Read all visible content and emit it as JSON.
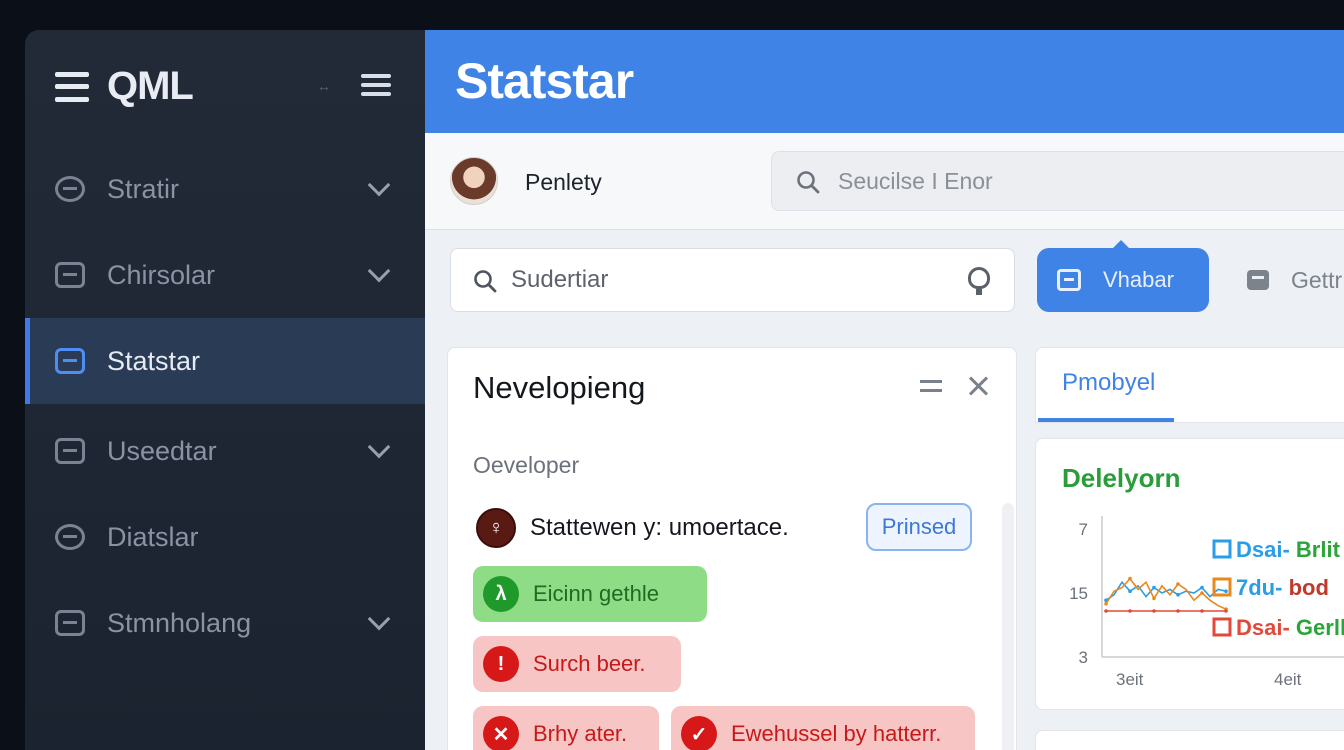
{
  "sidebar": {
    "brand": "QML",
    "arrows": "↔",
    "items": [
      {
        "label": "Stratir",
        "icon": "gauge-icon",
        "chevron": true,
        "active": false
      },
      {
        "label": "Chirsolar",
        "icon": "card-icon",
        "chevron": true,
        "active": false
      },
      {
        "label": "Statstar",
        "icon": "list-icon",
        "chevron": false,
        "active": true
      },
      {
        "label": "Useedtar",
        "icon": "card-icon",
        "chevron": true,
        "active": false
      },
      {
        "label": "Diatslar",
        "icon": "gauge-icon",
        "chevron": false,
        "active": false
      },
      {
        "label": "Stmnholang",
        "icon": "card-icon",
        "chevron": true,
        "active": false
      }
    ]
  },
  "header": {
    "title": "Statstar"
  },
  "userbar": {
    "user_name": "Penlety",
    "search_placeholder": "Seucilse I Enor"
  },
  "toolbar": {
    "filter_placeholder": "Sudertiar",
    "primary_button": "Vhabar",
    "ghost_button": "Gettr"
  },
  "panel": {
    "title": "Nevelopieng",
    "subtitle": "Oeveloper",
    "status_icon": "♀",
    "status_text": "Stattewen y: umoertace.",
    "status_pill": "Prinsed",
    "tags": [
      {
        "label": "Eicinn gethle",
        "icon": "λ",
        "tone": "green"
      },
      {
        "label": "Surch beer.",
        "icon": "!",
        "tone": "red"
      },
      {
        "label": "Brhy ater.",
        "icon": "✕",
        "tone": "red"
      },
      {
        "label": "Ewehussel by hatterr.",
        "icon": "✓",
        "tone": "red"
      }
    ]
  },
  "right_panel": {
    "tab": "Pmobyel",
    "chart_title": "Delelyorn"
  },
  "chart_data": {
    "type": "line",
    "title": "Delelyorn",
    "x_tick_labels": [
      "3eit",
      "4eit"
    ],
    "y_tick_labels": [
      "7",
      "15",
      "3"
    ],
    "series": [
      {
        "name": "Dsai- Brlit",
        "color": "#2a9de8",
        "values": [
          14.6,
          14.9,
          15.6,
          15.1,
          15.4,
          14.8,
          15.3,
          15.0,
          15.2,
          14.9,
          15.1,
          15.0,
          15.3,
          14.8,
          15.2,
          15.1
        ]
      },
      {
        "name": "7du- bod",
        "color": "#e8891e",
        "values": [
          14.4,
          15.1,
          15.3,
          15.8,
          15.2,
          15.6,
          14.7,
          15.4,
          14.9,
          15.5,
          15.2,
          14.6,
          15.0,
          14.6,
          14.3,
          14.1
        ]
      },
      {
        "name": "Dsai- Gerlk",
        "color": "#e14a3b",
        "values": [
          14.0,
          14.0,
          14.0,
          14.0,
          14.0,
          14.0,
          14.0,
          14.0,
          14.0,
          14.0,
          14.0,
          14.0,
          14.0,
          14.0,
          14.0,
          14.0
        ]
      }
    ],
    "legend": [
      {
        "label": "Dsai- Brlit",
        "marker": "#2a9de8",
        "text_colors": [
          "#2a9de8",
          "#2aa53a"
        ]
      },
      {
        "label": "7du- bod",
        "marker": "#e8891e",
        "text_colors": [
          "#2a9de8",
          "#c0392b"
        ]
      },
      {
        "label": "Dsai- Gerlk",
        "marker": "#e14a3b",
        "text_colors": [
          "#e14a3b",
          "#2aa53a"
        ]
      }
    ]
  },
  "colors": {
    "accent": "#3f83e6",
    "sidebar_bg": "#1c2330",
    "success": "#1f9a2a",
    "danger": "#d61818"
  }
}
